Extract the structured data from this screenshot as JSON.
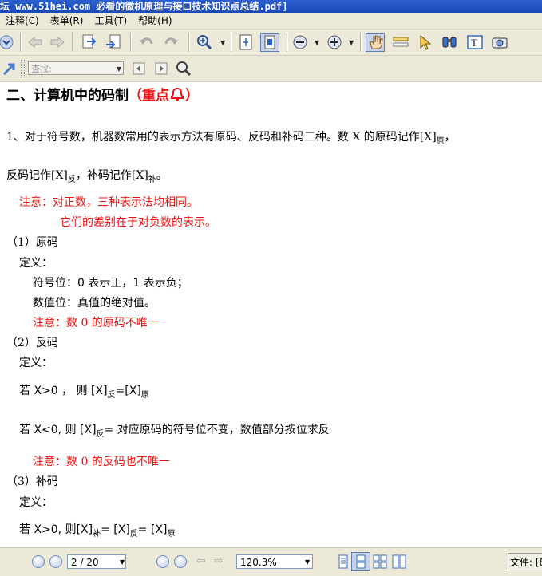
{
  "window": {
    "title": "坛 www.51hei.com 必看的微机原理与接口技术知识点总结.pdf]"
  },
  "menu": [
    "注释(C)",
    "表单(R)",
    "工具(T)",
    "帮助(H)"
  ],
  "toolbar": {
    "search_placeholder": "查找:"
  },
  "doc": {
    "heading": "二、计算机中的码制",
    "heading_note": "（重点",
    "heading_note_end": "）",
    "p1_a": "1、对于符号数，机器数常用的表示方法有原码、反码和补码三种。数 X 的原码记作[X]",
    "p1_sub": "原",
    "p1_end": "，",
    "p2_a": "反码记作[X]",
    "p2_sub1": "反",
    "p2_b": "，补码记作[X]",
    "p2_sub2": "补",
    "p2_end": "。",
    "note1": "注意：对正数，三种表示法均相同。",
    "note2": "它们的差别在于对负数的表示。",
    "s1": "（1）原码",
    "s1_def": "定义：",
    "s1_sign": "符号位：0 表示正，1 表示负；",
    "s1_val": "数值位：真值的绝对值。",
    "s1_note": "注意：数 0 的原码不唯一",
    "s2": "（2）反码",
    "s2_def": "定义：",
    "s2_pos_a": "若 X>0 ，  则    [X]",
    "s2_pos_sub1": "反",
    "s2_pos_b": "=[X]",
    "s2_pos_sub2": "原",
    "s2_neg_a": "若 X<0,    则    [X]",
    "s2_neg_sub": "反",
    "s2_neg_b": "=  对应原码的符号位不变，数值部分按位求反",
    "s2_note": "注意：数 0 的反码也不唯一",
    "s3": "（3）补码",
    "s3_def": "定义：",
    "s3_pos_a": "若 X>0,    则[X]",
    "s3_pos_sub1": "补",
    "s3_pos_b": "= [X]",
    "s3_pos_sub2": "反",
    "s3_pos_c": "= [X]",
    "s3_pos_sub3": "原"
  },
  "status": {
    "page": "2 / 20",
    "zoom": "120.3%",
    "file_label": "文件: [8"
  },
  "colors": {
    "accent_red": "#e11111",
    "chrome": "#ece9d8",
    "title_blue": "#1b49b6"
  }
}
